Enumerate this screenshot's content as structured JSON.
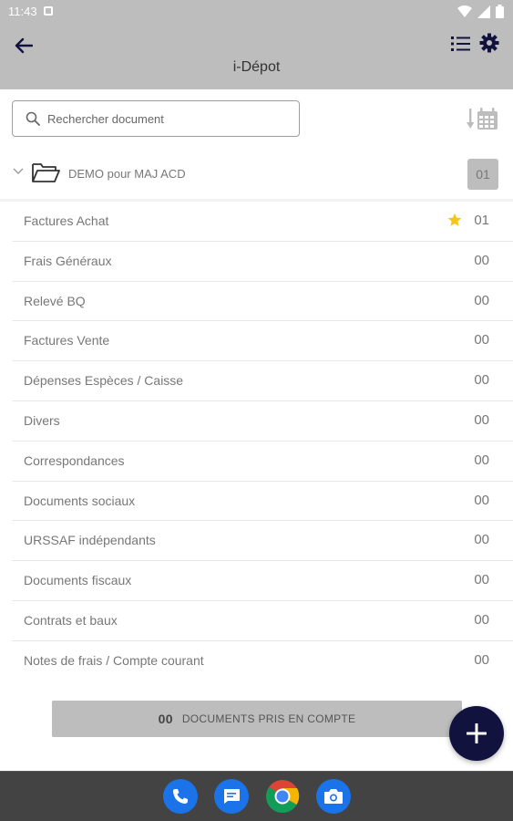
{
  "status_bar": {
    "time": "11:43",
    "icons": [
      "notification-icon",
      "wifi-icon",
      "signal-icon",
      "battery-icon"
    ]
  },
  "app_bar": {
    "title": "i-Dépot",
    "icons": [
      "back-arrow-icon",
      "list-view-icon",
      "gear-icon"
    ]
  },
  "search": {
    "placeholder": "Rechercher document"
  },
  "folder": {
    "label": "DEMO pour MAJ ACD",
    "count": "01"
  },
  "categories": [
    {
      "label": "Factures Achat",
      "count": "01",
      "starred": true
    },
    {
      "label": "Frais Généraux",
      "count": "00"
    },
    {
      "label": "Relevé BQ",
      "count": "00"
    },
    {
      "label": "Factures Vente",
      "count": "00"
    },
    {
      "label": "Dépenses Espèces / Caisse",
      "count": "00"
    },
    {
      "label": "Divers",
      "count": "00"
    },
    {
      "label": "Correspondances",
      "count": "00"
    },
    {
      "label": "Documents sociaux",
      "count": "00"
    },
    {
      "label": "URSSAF indépendants",
      "count": "00"
    },
    {
      "label": "Documents fiscaux",
      "count": "00"
    },
    {
      "label": "Contrats et baux",
      "count": "00"
    },
    {
      "label": "Notes de frais / Compte courant",
      "count": "00"
    }
  ],
  "footer": {
    "docs_count": "00",
    "docs_label": "DOCUMENTS PRIS EN COMPTE"
  },
  "dock_apps": [
    "phone-icon",
    "messages-icon",
    "chrome-icon",
    "camera-icon"
  ],
  "colors": {
    "app_bar": "#bdbdbd",
    "fab": "#12123f",
    "star": "#f5c518",
    "dock": "#434343"
  }
}
